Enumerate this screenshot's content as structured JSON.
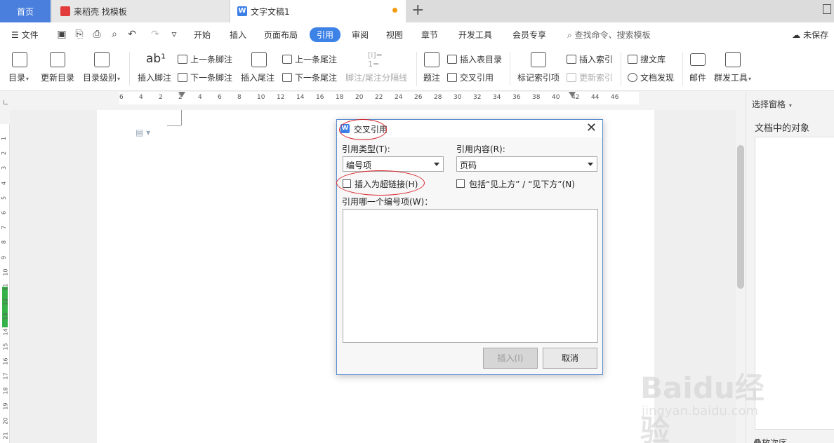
{
  "tabs": {
    "home": "首页",
    "daoke": "来稻壳 找模板",
    "doc": "文字文稿1"
  },
  "menubar": {
    "file": "文件",
    "tabs": [
      "开始",
      "插入",
      "页面布局",
      "引用",
      "审阅",
      "视图",
      "章节",
      "开发工具",
      "会员专享"
    ],
    "active_tab": "引用",
    "search": "查找命令、搜索模板",
    "save_status": "未保存"
  },
  "ribbon": {
    "toc": "目录",
    "update_toc": "更新目录",
    "toc_level": "目录级别",
    "insert_footnote": "插入脚注",
    "prev_footnote": "上一条脚注",
    "next_footnote": "下一条脚注",
    "insert_endnote": "插入尾注",
    "prev_endnote": "上一条尾注",
    "next_endnote": "下一条尾注",
    "note_separator": "脚注/尾注分隔线",
    "caption": "题注",
    "insert_table_of_figures": "插入表目录",
    "cross_reference": "交叉引用",
    "mark_index_entry": "标记索引项",
    "insert_index": "插入索引",
    "update_index": "更新索引",
    "search_library": "搜文库",
    "doc_discovery": "文档发现",
    "mail": "邮件",
    "mass_tools": "群发工具"
  },
  "ruler": {
    "h_ticks": [
      "6",
      "4",
      "2",
      "2",
      "4",
      "6",
      "8",
      "10",
      "12",
      "14",
      "16",
      "18",
      "20",
      "22",
      "24",
      "26",
      "28",
      "30",
      "32",
      "34",
      "36",
      "38",
      "40",
      "42",
      "44",
      "46"
    ],
    "v_ticks": [
      "1",
      "2",
      "3",
      "4",
      "5",
      "6",
      "7",
      "8",
      "9",
      "10",
      "11",
      "12",
      "13",
      "14",
      "15",
      "16",
      "17",
      "18",
      "19",
      "20",
      "21"
    ]
  },
  "right_pane": {
    "title": "选择窗格",
    "subtitle": "文档中的对象",
    "bottom": "叠放次序"
  },
  "dialog": {
    "title": "交叉引用",
    "ref_type_label": "引用类型(T):",
    "ref_type_value": "编号项",
    "ref_content_label": "引用内容(R):",
    "ref_content_value": "页码",
    "insert_hyperlink": "插入为超链接(H)",
    "include_above_below": "包括“见上方” / “见下方”(N)",
    "which_item_label": "引用哪一个编号项(W)：",
    "insert_button": "插入(I)",
    "cancel_button": "取消"
  },
  "watermark": {
    "brand": "Baidu经验",
    "url": "jingyan.baidu.com"
  }
}
